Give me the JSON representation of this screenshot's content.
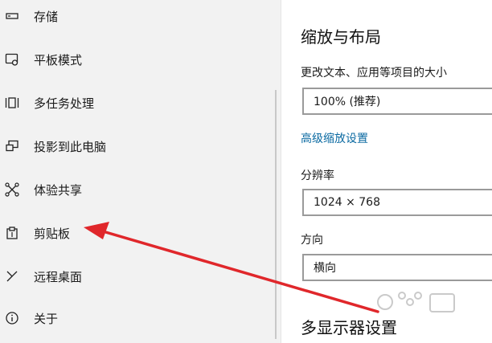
{
  "sidebar": {
    "items": [
      {
        "label": "存储",
        "icon": "storage-icon"
      },
      {
        "label": "平板模式",
        "icon": "tablet-mode-icon"
      },
      {
        "label": "多任务处理",
        "icon": "multitasking-icon"
      },
      {
        "label": "投影到此电脑",
        "icon": "projecting-icon"
      },
      {
        "label": "体验共享",
        "icon": "shared-experiences-icon"
      },
      {
        "label": "剪贴板",
        "icon": "clipboard-icon"
      },
      {
        "label": "远程桌面",
        "icon": "remote-desktop-icon"
      },
      {
        "label": "关于",
        "icon": "info-icon"
      }
    ]
  },
  "content": {
    "scale_layout_title": "缩放与布局",
    "scale_label": "更改文本、应用等项目的大小",
    "scale_value": "100% (推荐)",
    "advanced_scaling_link": "高级缩放设置",
    "resolution_label": "分辨率",
    "resolution_value": "1024 × 768",
    "orientation_label": "方向",
    "orientation_value": "横向",
    "multiple_displays_title": "多显示器设置"
  },
  "colors": {
    "link": "#0b6aa2",
    "annotation_arrow": "#e0272b",
    "sidebar_bg": "#f2f2f2"
  }
}
